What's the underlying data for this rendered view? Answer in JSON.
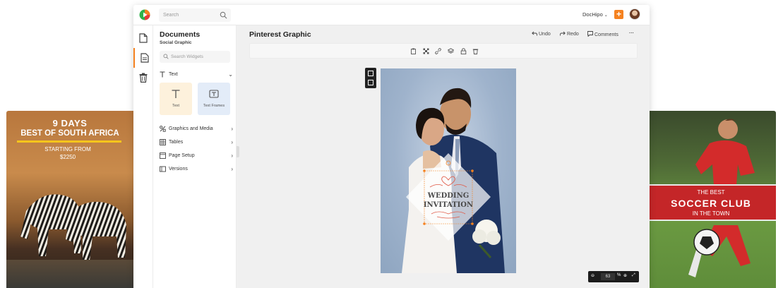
{
  "left_promo": {
    "line1": "9 DAYS",
    "line2": "BEST OF SOUTH AFRICA",
    "line3": "STARTING FROM",
    "line4": "$2250"
  },
  "right_promo": {
    "line1": "THE BEST",
    "line2": "SOCCER CLUB",
    "line3": "IN THE TOWN"
  },
  "topbar": {
    "search_placeholder": "Search",
    "account_label": "DocHipo",
    "add_label": "+"
  },
  "panel": {
    "title": "Documents",
    "subtitle": "Social Graphic",
    "widget_search_placeholder": "Search Widgets",
    "sections": {
      "text": "Text",
      "graphics": "Graphics and Media",
      "tables": "Tables",
      "page_setup": "Page Setup",
      "versions": "Versions"
    },
    "tiles": {
      "text": "Text",
      "text_frames": "Text Frames"
    }
  },
  "workspace": {
    "doc_title": "Pinterest Graphic",
    "undo": "Undo",
    "redo": "Redo",
    "comments": "Comments",
    "more": "···"
  },
  "canvas": {
    "line1": "WEDDING",
    "line2": "INVITATION"
  },
  "zoom": {
    "value": "63",
    "unit": "%"
  },
  "colors": {
    "accent": "#f58220",
    "invitation_red": "#e05a47"
  }
}
